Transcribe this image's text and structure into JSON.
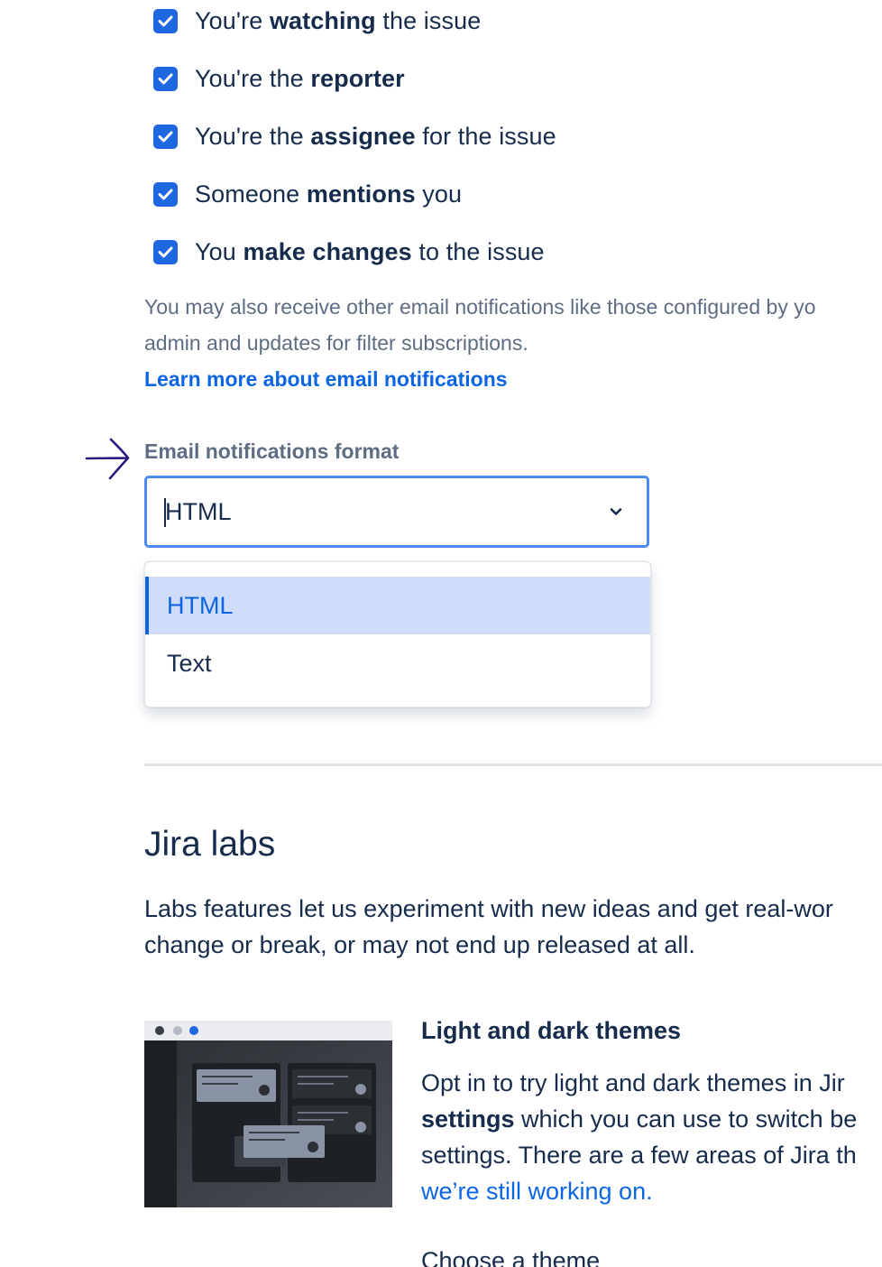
{
  "notifications": {
    "checkboxes": [
      {
        "checked": true,
        "pre": "You're ",
        "bold": "watching",
        "post": " the issue"
      },
      {
        "checked": true,
        "pre": "You're the ",
        "bold": "reporter",
        "post": ""
      },
      {
        "checked": true,
        "pre": "You're the ",
        "bold": "assignee",
        "post": " for the issue"
      },
      {
        "checked": true,
        "pre": "Someone ",
        "bold": "mentions",
        "post": " you"
      },
      {
        "checked": true,
        "pre": "You ",
        "bold": "make changes",
        "post": " to the issue"
      }
    ],
    "note_line1": "You may also receive other email notifications like those configured by yo",
    "note_line2": "admin and updates for filter subscriptions.",
    "learn_more": "Learn more about email notifications"
  },
  "format": {
    "label": "Email notifications format",
    "selected": "HTML",
    "options": [
      "HTML",
      "Text"
    ]
  },
  "labs": {
    "title": "Jira labs",
    "desc_line1": "Labs features let us experiment with new ideas and get real-wor",
    "desc_line2": "change or break, or may not end up released at all.",
    "feature": {
      "title": "Light and dark themes",
      "line1": "Opt in to try light and dark themes in Jir",
      "line2_bold": "settings",
      "line2_rest": " which you can use to switch be",
      "line3": "settings. There are a few areas of Jira th",
      "line4_link": "we’re still working on."
    },
    "cutoff_text": "Choose a theme"
  },
  "colors": {
    "accent": "#0C66E4",
    "checkbox": "#1D68E0",
    "focus_border": "#4C8BF5",
    "selected_bg": "#CFDDFA",
    "text": "#172B4D",
    "subtle": "#5E6C84",
    "annotation_arrow": "#2A1A80"
  },
  "icons": {
    "checkbox": "check-icon",
    "select": "chevron-down-icon",
    "annotation": "arrow-right-icon"
  }
}
